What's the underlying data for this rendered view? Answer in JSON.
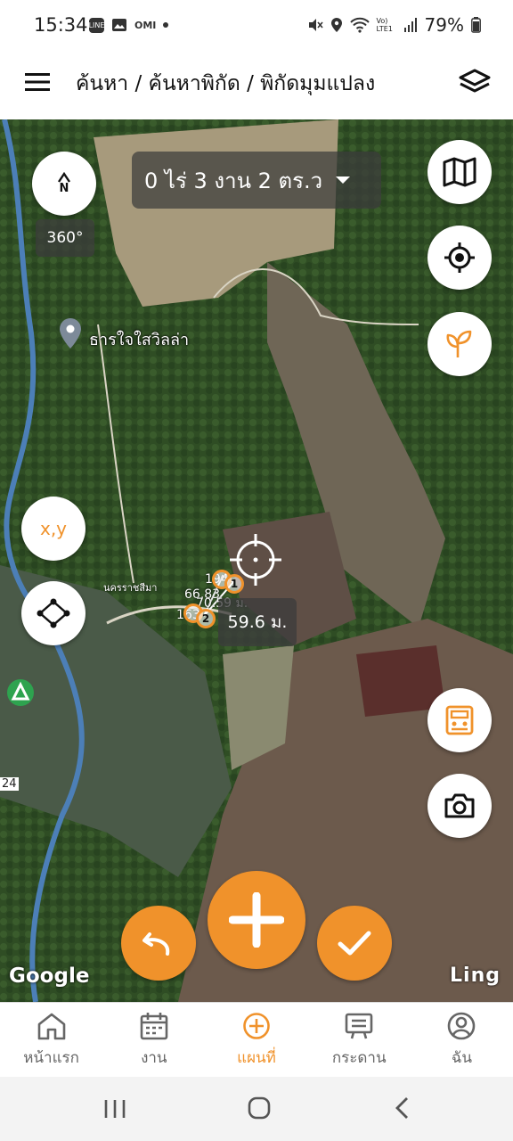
{
  "status_bar": {
    "time": "15:34",
    "app_icons": [
      "LINE",
      "OMI"
    ],
    "network": "Vo) LTE1",
    "battery": "79%"
  },
  "header": {
    "breadcrumb": "ค้นหา / ค้นหาพิกัด / พิกัดมุมแปลง"
  },
  "map": {
    "area_text": "0 ไร่ 3 งาน 2 ตร.ว",
    "compass_label": "N",
    "rotation_label": "360°",
    "place_name": "ธารใจใสวิลล่า",
    "road_label": "นครราชสีมา",
    "point_labels": {
      "p1_num": "1",
      "p2_num": "2",
      "p1_text": "194",
      "mid_text": "66.83",
      "seg_text": "70.59 ม.",
      "p2_text": "163"
    },
    "distance": "59.6 ม.",
    "coord_button": "x,y",
    "route_number": "24",
    "attribution": "Google",
    "brand": "Ling"
  },
  "bottom_nav": {
    "items": [
      {
        "label": "หน้าแรก",
        "icon": "home-icon"
      },
      {
        "label": "งาน",
        "icon": "calendar-icon"
      },
      {
        "label": "แผนที่",
        "icon": "add-circle-icon"
      },
      {
        "label": "กระดาน",
        "icon": "board-icon"
      },
      {
        "label": "ฉัน",
        "icon": "user-icon"
      }
    ],
    "active": "แผนที่"
  },
  "colors": {
    "accent": "#f0922b",
    "header_bg": "#ffffff",
    "pill_bg": "#3c3c3c"
  }
}
